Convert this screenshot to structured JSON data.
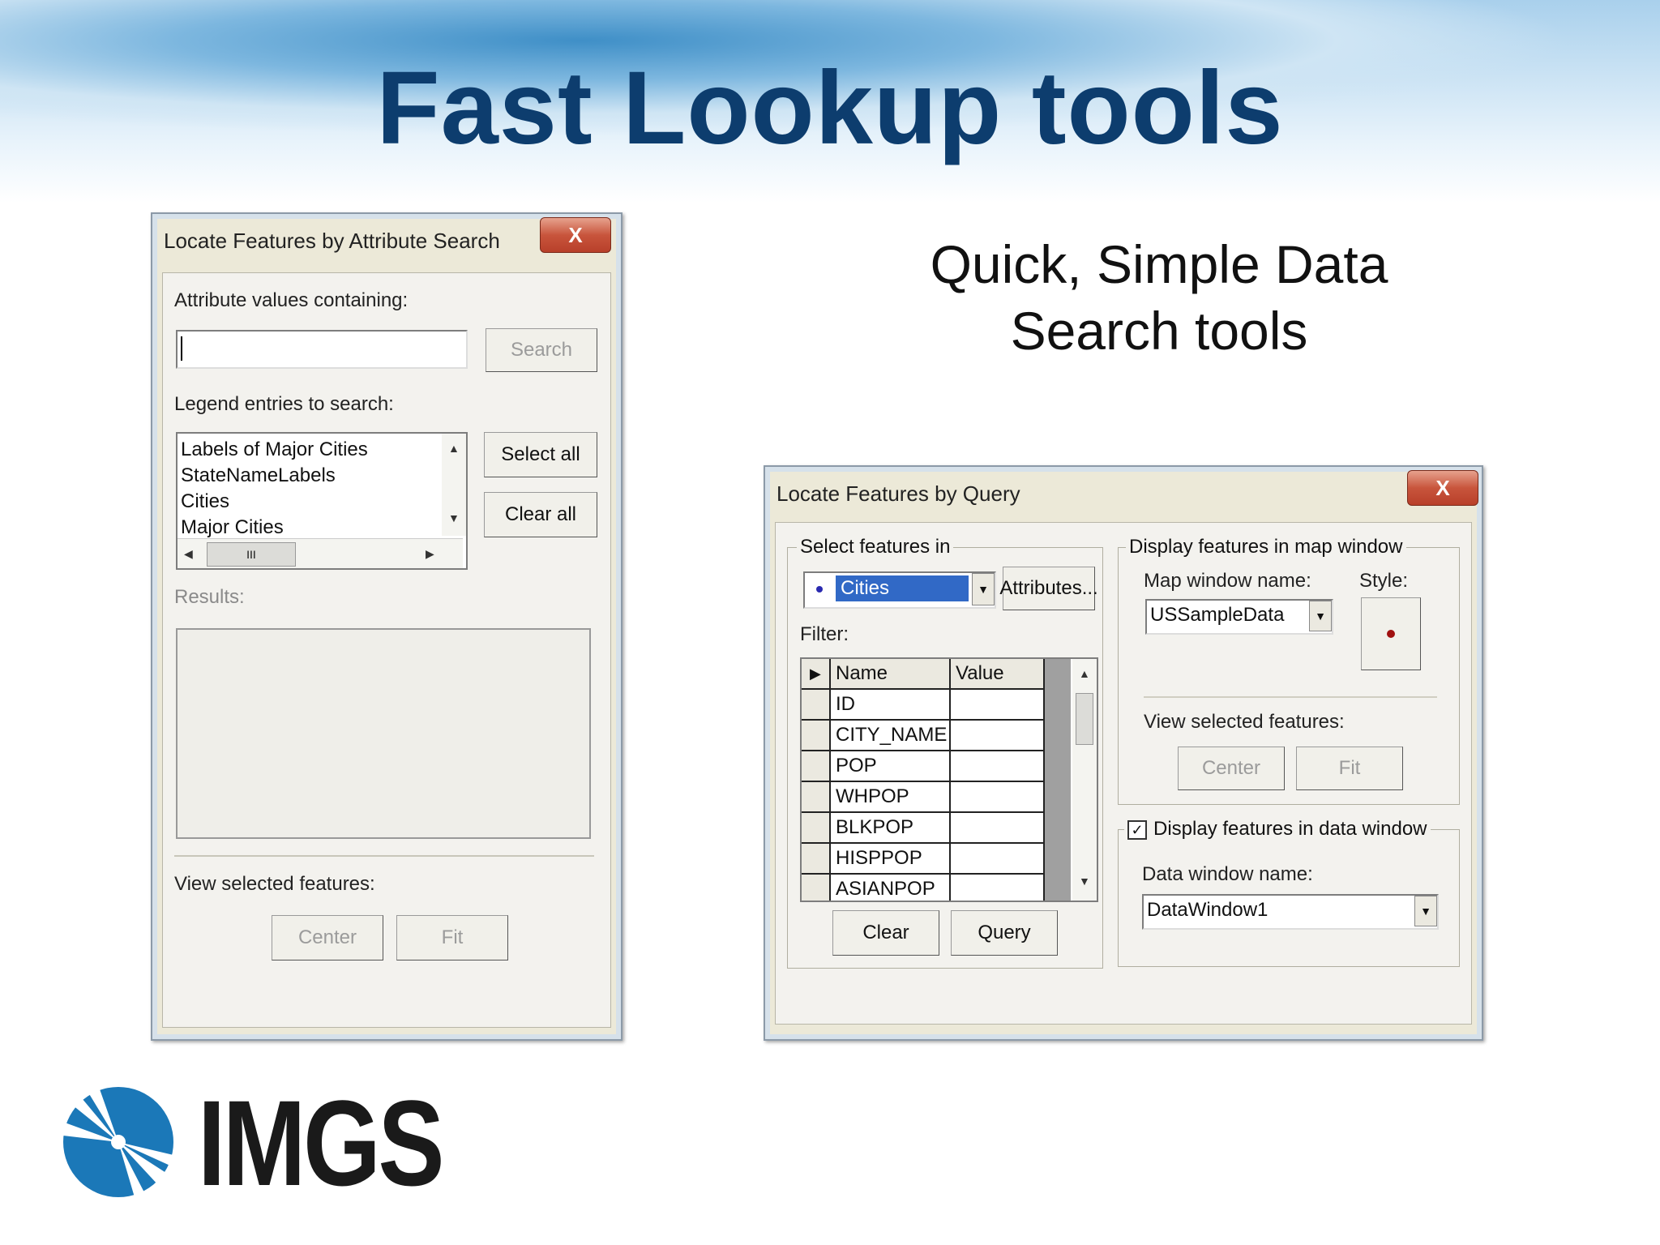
{
  "slide": {
    "title": "Fast Lookup tools",
    "subtitle_line1": "Quick, Simple Data",
    "subtitle_line2": "Search tools",
    "logo_text": "IMGS"
  },
  "dialog_attr": {
    "title": "Locate Features by Attribute Search",
    "close": "X",
    "attr_label": "Attribute values containing:",
    "search_value": "",
    "search_button": "Search",
    "legend_label": "Legend entries to search:",
    "legend_items": [
      "Labels of Major Cities",
      "StateNameLabels",
      "Cities",
      "Major Cities"
    ],
    "select_all": "Select all",
    "clear_all": "Clear all",
    "scroll_thumb": "III",
    "results_label": "Results:",
    "view_label": "View selected features:",
    "center": "Center",
    "fit": "Fit"
  },
  "dialog_query": {
    "title": "Locate Features by Query",
    "close": "X",
    "select_group": "Select features in",
    "layer_value": "Cities",
    "attributes_button": "Attributes...",
    "filter_label": "Filter:",
    "grid_headers": [
      "Name",
      "Value"
    ],
    "grid_rows": [
      "ID",
      "CITY_NAME",
      "POP",
      "WHPOP",
      "BLKPOP",
      "HISPPOP",
      "ASIANPOP"
    ],
    "clear_button": "Clear",
    "query_button": "Query",
    "map_group": "Display features in map window",
    "map_name_label": "Map window name:",
    "map_name_value": "USSampleData",
    "style_label": "Style:",
    "view_label": "View selected features:",
    "center": "Center",
    "fit": "Fit",
    "data_group": "Display features in data window",
    "data_checked": true,
    "check_mark": "✓",
    "data_name_label": "Data window name:",
    "data_name_value": "DataWindow1"
  },
  "colors": {
    "title": "#0d3d6e",
    "style_dot": "#a01010",
    "selection": "#3169c6"
  }
}
